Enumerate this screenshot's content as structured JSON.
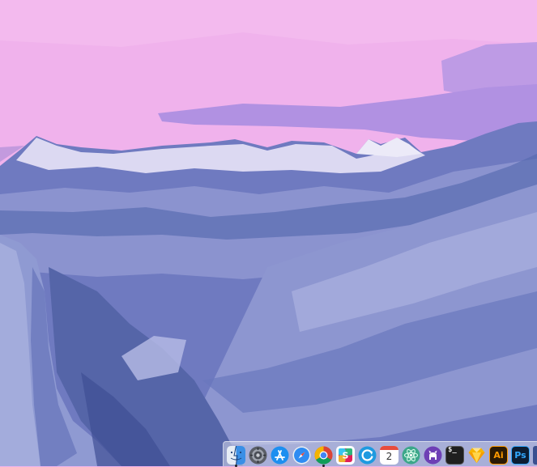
{
  "desktop": {
    "wallpaper": "mountain-valley-landscape",
    "colors": {
      "sky": "#f0b2ec",
      "cloud": "#b493e6",
      "mountain": "#5f6fb5",
      "snow": "#d7d9f2"
    }
  },
  "dock": {
    "items": [
      {
        "name": "finder",
        "icon": "finder-icon",
        "running": true
      },
      {
        "name": "system-preferences",
        "icon": "gear-icon",
        "running": false
      },
      {
        "name": "app-store",
        "icon": "app-store-icon",
        "running": false
      },
      {
        "name": "safari",
        "icon": "compass-icon",
        "running": false
      },
      {
        "name": "chrome",
        "icon": "chrome-icon",
        "running": true
      },
      {
        "name": "slack",
        "icon": "slack-icon",
        "running": false
      },
      {
        "name": "sync",
        "icon": "sync-icon",
        "running": false
      },
      {
        "name": "calendar",
        "icon": "calendar-icon",
        "label": "2",
        "running": false
      },
      {
        "name": "atom",
        "icon": "atom-icon",
        "running": false
      },
      {
        "name": "github-desktop",
        "icon": "github-icon",
        "running": false
      },
      {
        "name": "terminal",
        "icon": "terminal-icon",
        "label": "$_",
        "running": false
      },
      {
        "name": "sketch",
        "icon": "sketch-icon",
        "running": false
      },
      {
        "name": "illustrator",
        "icon": "illustrator-icon",
        "label": "Ai",
        "running": false
      },
      {
        "name": "photoshop",
        "icon": "photoshop-icon",
        "label": "Ps",
        "running": false
      }
    ]
  }
}
